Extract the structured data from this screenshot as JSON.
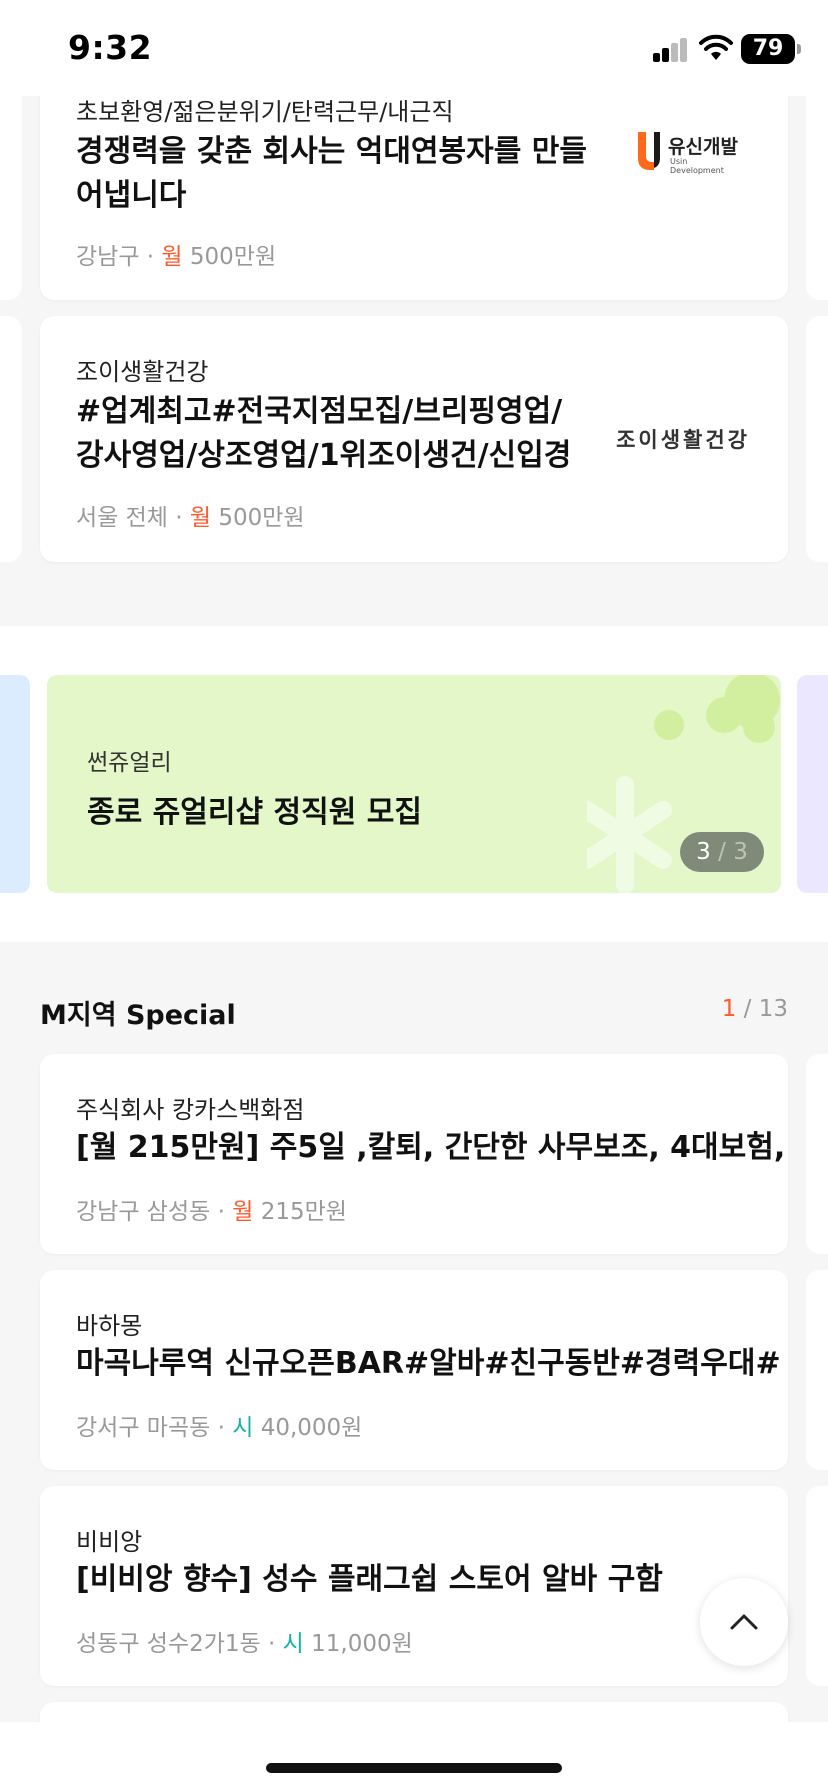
{
  "status_bar": {
    "time": "9:32",
    "battery": "79"
  },
  "top_cards": [
    {
      "company": "초보환영/젊은분위기/탄력근무/내근직",
      "title_line1": "경쟁력을 갖춘 회사는 억대연봉자를 만들",
      "title_line2": "어냅니다",
      "location": "강남구",
      "pay_type": "월",
      "pay_amount": "500만원",
      "logo_text": "유신개발",
      "logo_sub": "Usin Development"
    },
    {
      "company": "조이생활건강",
      "title_line1": "#업계최고#전국지점모집/브리핑영업/",
      "title_line2": "강사영업/상조영업/1위조이생건/신입경",
      "location": "서울 전체",
      "pay_type": "월",
      "pay_amount": "500만원",
      "logo_text": "조이생활건강"
    }
  ],
  "banner": {
    "company": "썬쥬얼리",
    "title": "종로 쥬얼리샵 정직원 모집",
    "page_current": "3",
    "page_total": "3",
    "bg_color": "#e3f7c9"
  },
  "special_section": {
    "title": "M지역 Special",
    "page_current": "1",
    "page_total": "13",
    "cards": [
      {
        "company": "주식회사 캉카스백화점",
        "title": "[월 215만원] 주5일 ,칼퇴, 간단한 사무보조, 4대보험,",
        "location": "강남구 삼성동",
        "pay_type": "월",
        "pay_amount": "215만원"
      },
      {
        "company": "바하몽",
        "title": "마곡나루역 신규오픈BAR#알바#친구동반#경력우대#",
        "location": "강서구 마곡동",
        "pay_type": "시",
        "pay_amount": "40,000원"
      },
      {
        "company": "비비앙",
        "title": "[비비앙 향수] 성수 플래그쉽 스토어 알바 구함",
        "location": "성동구 성수2가1동",
        "pay_type": "시",
        "pay_amount": "11,000원"
      }
    ]
  },
  "colors": {
    "accent_orange": "#ff5a2c",
    "accent_teal": "#17b1a5"
  },
  "icons": {
    "scroll_top": "chevron-up-icon"
  }
}
